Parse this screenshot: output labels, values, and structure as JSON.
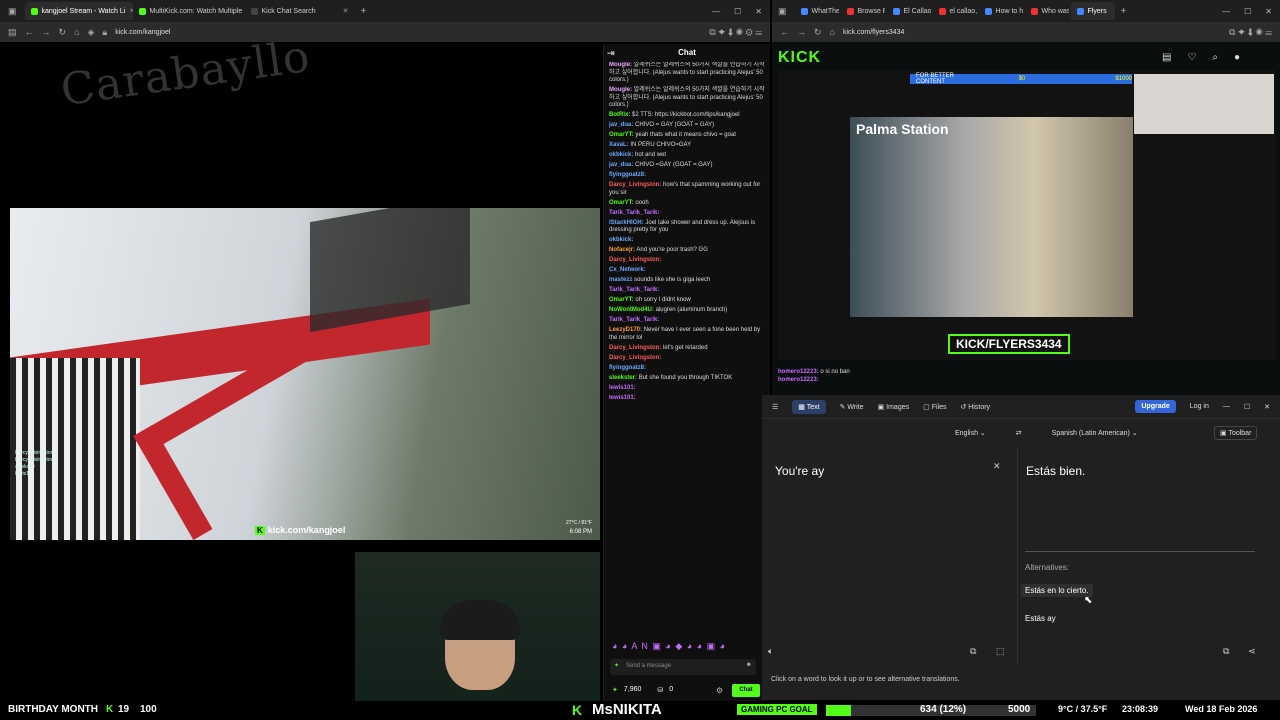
{
  "left_browser": {
    "tabs": [
      {
        "label": "kangjoel Stream - Watch Li",
        "active": true
      },
      {
        "label": "MultiKick.com: Watch Multiple",
        "active": false
      },
      {
        "label": "Kick Chat Search",
        "active": false
      }
    ],
    "url": "kick.com/kangjoel"
  },
  "stream": {
    "bus_text": "Carabayllo",
    "watermark": "kick.com/kangjoel",
    "weather": "27°C / 81°F",
    "time": "6:08 PM",
    "mini_chat": [
      "Darcy_Livingston",
      "Darcy_Livingston",
      "sleekster",
      "lewis101"
    ]
  },
  "chat": {
    "title": "Chat",
    "messages": [
      {
        "user": "Mougle:",
        "text": "알레쉬스는 알레쉬스의 50가지 색깔을 연습하기 시작하고 싶어합니다. (Alejus wants to start practicing Alejus' 50 colors.)",
        "color": "#e5a8ff"
      },
      {
        "user": "Mougle:",
        "text": "알레쉬스는 알레쉬스의 50가지 색깔을 연습하기 시작하고 싶어합니다. (Alejus wants to start practicing Alejus' 50 colors.)",
        "color": "#e5a8ff"
      },
      {
        "user": "BotRix:",
        "text": "$2 TTS: https://kickbot.com/tips/kangjoel",
        "color": "#53fc18"
      },
      {
        "user": "jav_dua:",
        "text": "CHIVO = GAY (GOAT = GAY)",
        "color": "#6aa9ff"
      },
      {
        "user": "OmarYT:",
        "text": "yeah thats what it means chivo = goat",
        "color": "#53fc18"
      },
      {
        "user": "XavaL:",
        "text": "IN PERU CHIVO=GAY",
        "color": "#6aa9ff"
      },
      {
        "user": "okbkick:",
        "text": "hot and wet",
        "color": "#6aa9ff"
      },
      {
        "user": "jav_dua:",
        "text": "CHIVO =GAY (GOAT = GAY)",
        "color": "#6aa9ff"
      },
      {
        "user": "flyinggoatz8:",
        "text": "",
        "color": "#6aa9ff"
      },
      {
        "user": "Darcy_Livingston:",
        "text": "how's that spamming working out for you sir",
        "color": "#ff5a5a"
      },
      {
        "user": "OmarYT:",
        "text": "oooh",
        "color": "#53fc18"
      },
      {
        "user": "Tarik_Tarik_Tarik:",
        "text": "",
        "color": "#c76bff"
      },
      {
        "user": "lStackHIGH:",
        "text": "Joel take shower and dress up. Alejsus is dressing pretty for you",
        "color": "#6aa9ff"
      },
      {
        "user": "okbkick:",
        "text": "",
        "color": "#6aa9ff"
      },
      {
        "user": "Nofacejr:",
        "text": "And you're poor trash? GG",
        "color": "#ff9a3c"
      },
      {
        "user": "Darcy_Livingston:",
        "text": "",
        "color": "#ff5a5a"
      },
      {
        "user": "Cx_Network:",
        "text": "",
        "color": "#6aa9ff"
      },
      {
        "user": "mastezz",
        "text": "sounds like she is giga leech",
        "color": "#6aa9ff"
      },
      {
        "user": "Tarik_Tarik_Tarik:",
        "text": "",
        "color": "#c76bff"
      },
      {
        "user": "OmarYT:",
        "text": "oh sorry I didnt know",
        "color": "#53fc18"
      },
      {
        "user": "NoWontMod4U:",
        "text": "alugren (aluminum branch)",
        "color": "#53fc18"
      },
      {
        "user": "Tarik_Tarik_Tarik:",
        "text": "",
        "color": "#c76bff"
      },
      {
        "user": "LeezyD170:",
        "text": "Never have I ever seen a fone been held by the mirror lol",
        "color": "#ff9a3c"
      },
      {
        "user": "Darcy_Livingston:",
        "text": "let's get retarded",
        "color": "#ff5a5a"
      },
      {
        "user": "Darcy_Livingston:",
        "text": "",
        "color": "#ff5a5a"
      },
      {
        "user": "flyinggoatz8:",
        "text": "",
        "color": "#6aa9ff"
      },
      {
        "user": "sleekster:",
        "text": "But she found you through TIKTOK",
        "color": "#53fc18"
      },
      {
        "user": "lewis101:",
        "text": "",
        "color": "#c76bff"
      },
      {
        "user": "lewis101:",
        "text": "",
        "color": "#c76bff"
      }
    ],
    "input_placeholder": "Send a message",
    "points": "7,960",
    "count": "0",
    "send_label": "Chat"
  },
  "right_browser": {
    "tabs": [
      "WhatThe",
      "Browse F",
      "El Callao",
      "el callao,",
      "How to h",
      "Who was",
      "Flyers"
    ],
    "url": "kick.com/flyers3434",
    "logo": "KICK",
    "banner": "FOR BETTER CONTENT",
    "banner_amount": "$0",
    "banner_goal": "$1000",
    "station": "Palma Station",
    "streamer": "KICK/FLYERS3434",
    "chat_lines": [
      {
        "user": "homero12223:",
        "text": "o si no ban"
      },
      {
        "user": "homero12223:",
        "text": ""
      }
    ]
  },
  "translator": {
    "tabs": [
      "Text",
      "Write",
      "Images",
      "Files",
      "History"
    ],
    "upgrade": "Upgrade",
    "login": "Log in",
    "source_lang": "English",
    "target_lang": "Spanish (Latin American)",
    "toolbar_label": "Toolbar",
    "source_text": "You're ay",
    "target_text": "Estás bien.",
    "alternatives_label": "Alternatives:",
    "alternatives": [
      "Estás en lo cierto.",
      "Estás ay"
    ],
    "hint": "Click on a word to look it up or to see alternative translations."
  },
  "overlay": {
    "left_text": "BIRTHDAY MONTH",
    "kick_count": "19",
    "count2": "100",
    "streamer": "MsNIKITA",
    "goal_label": "GAMING PC GOAL",
    "goal_progress": "634 (12%)",
    "goal_target": "5000",
    "temp": "9°C / 37.5°F",
    "clock": "23:08:39",
    "date": "Wed 18 Feb 2026"
  }
}
